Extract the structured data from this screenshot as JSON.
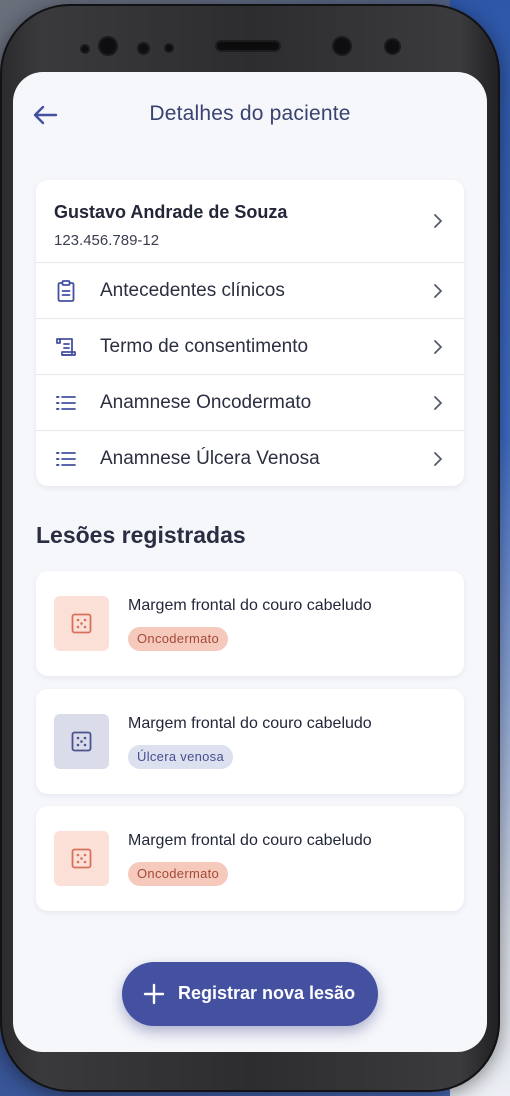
{
  "header": {
    "title": "Detalhes do paciente"
  },
  "patient": {
    "name": "Gustavo Andrade de Souza",
    "document": "123.456.789-12"
  },
  "menu": {
    "items": [
      {
        "label": "Antecedentes clínicos",
        "icon": "clipboard-icon"
      },
      {
        "label": "Termo de consentimento",
        "icon": "scroll-document-icon"
      },
      {
        "label": "Anamnese Oncodermato",
        "icon": "list-icon"
      },
      {
        "label": "Anamnese Úlcera Venosa",
        "icon": "list-icon"
      }
    ]
  },
  "lesions": {
    "section_title": "Lesões registradas",
    "items": [
      {
        "title": "Margem frontal do couro cabeludo",
        "tag": "Oncodermato",
        "type": "onco"
      },
      {
        "title": "Margem frontal do couro cabeludo",
        "tag": "Úlcera venosa",
        "type": "ulcera"
      },
      {
        "title": "Margem frontal do couro cabeludo",
        "tag": "Oncodermato",
        "type": "onco"
      }
    ]
  },
  "actions": {
    "register_lesion": "Registrar nova lesão"
  },
  "colors": {
    "primary": "#4450a0",
    "title_text": "#3a4270",
    "onco_tag_bg": "#f6c9bd",
    "onco_tag_text": "#a54a37",
    "ulcera_tag_bg": "#dde0ef",
    "ulcera_tag_text": "#47508e",
    "screen_bg": "#f6f7fb"
  }
}
